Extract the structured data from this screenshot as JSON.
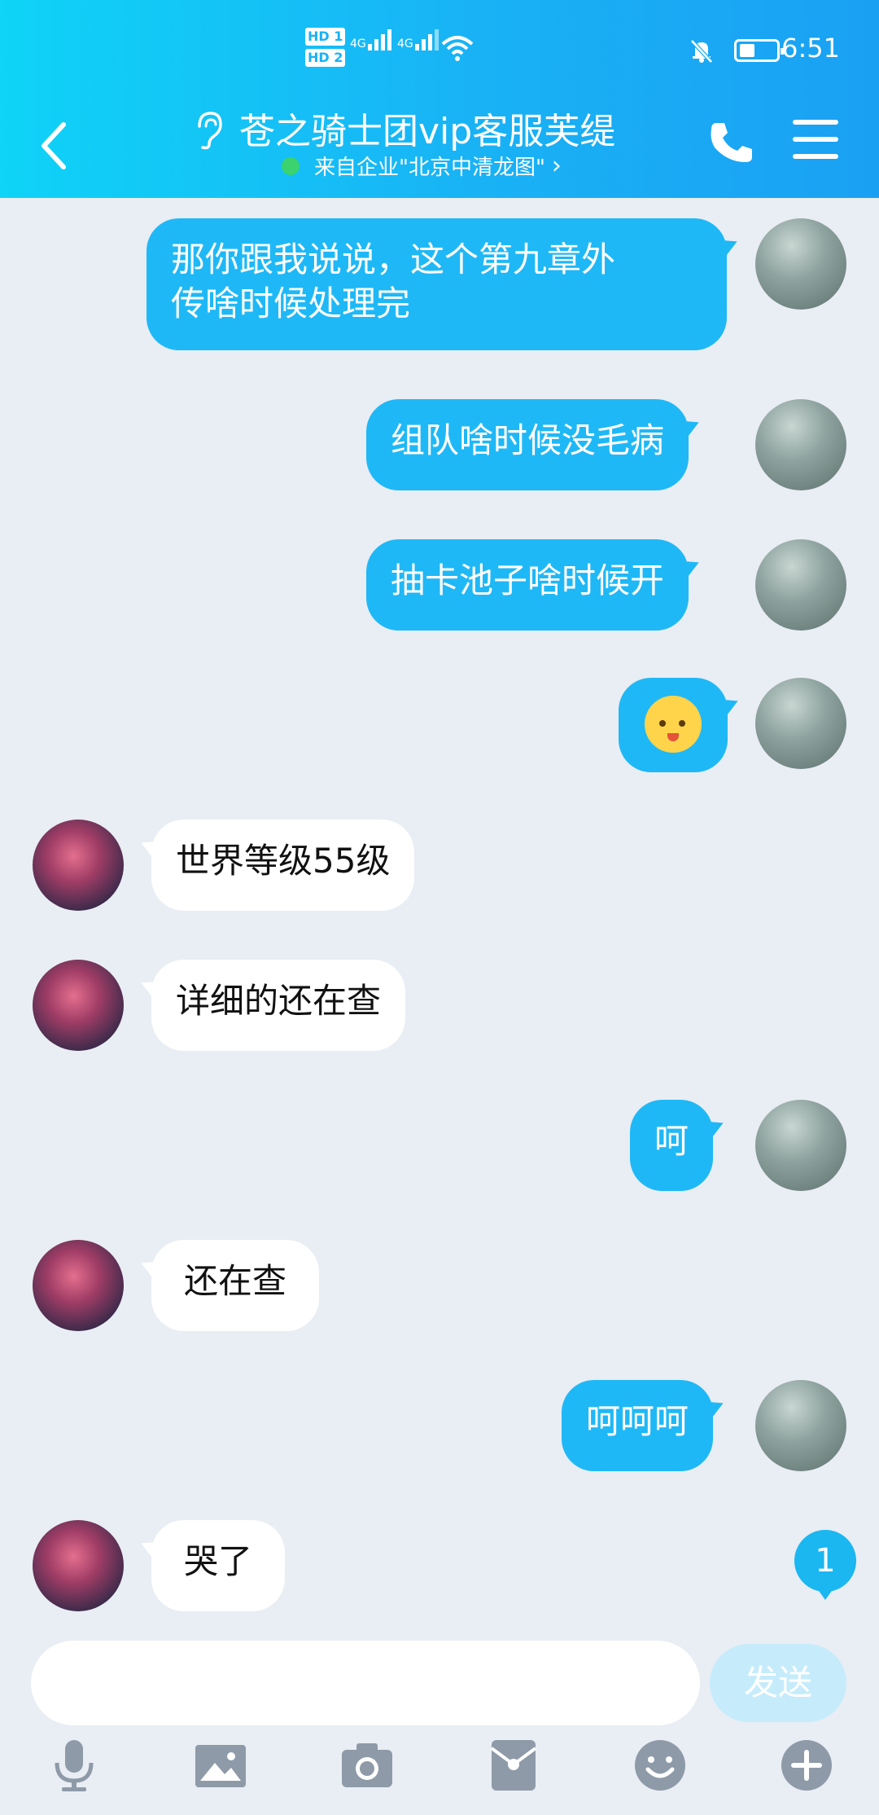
{
  "status_bar": {
    "hd1": "HD 1",
    "hd2": "HD 2",
    "net1": "4G",
    "net2": "4G",
    "time": "6:51"
  },
  "header": {
    "title": "苍之骑士团vip客服芙缇",
    "subtitle": "来自企业\"北京中清龙图\"",
    "subtitle_chevron": "›"
  },
  "messages": [
    {
      "from": "me",
      "lines": [
        "那你跟我说说，这个第九章外",
        "传啥时候处理完"
      ]
    },
    {
      "from": "me",
      "text": "组队啥时候没毛病"
    },
    {
      "from": "me",
      "text": "抽卡池子啥时候开"
    },
    {
      "from": "me",
      "emoji": "smiley-tongue-emoji"
    },
    {
      "from": "them",
      "text": "世界等级55级"
    },
    {
      "from": "them",
      "text": "详细的还在查"
    },
    {
      "from": "me",
      "text": "呵"
    },
    {
      "from": "them",
      "text": "还在查"
    },
    {
      "from": "me",
      "text": "呵呵呵"
    },
    {
      "from": "them",
      "text": "哭了"
    }
  ],
  "unread_count": "1",
  "input": {
    "value": "",
    "send_label": "发送"
  },
  "toolbar": [
    "microphone-icon",
    "image-icon",
    "camera-icon",
    "red-packet-icon",
    "emoji-icon",
    "plus-icon"
  ],
  "colors": {
    "header_start": "#0fd3f7",
    "header_end": "#1aa0f3",
    "bubble_me": "#1fb8f6",
    "bubble_them": "#ffffff",
    "background": "#e9edf4"
  }
}
